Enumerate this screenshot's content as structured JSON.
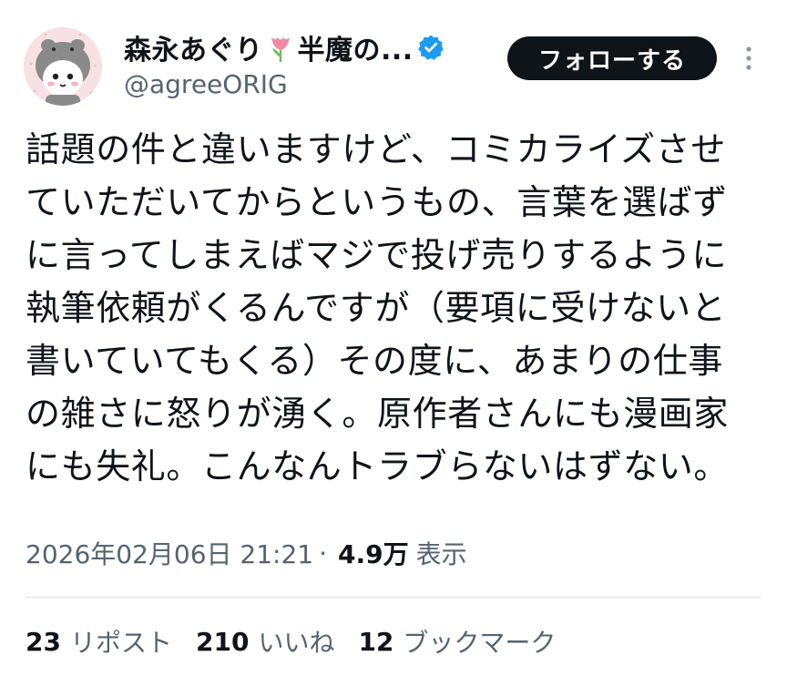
{
  "author": {
    "display_name": "森永あぐり",
    "display_name_suffix": "半魔の...",
    "name_emoji": "tulip-icon",
    "verified_icon": "verified-badge-icon",
    "handle": "@agreeORIG",
    "avatar_colors": {
      "background": "#f6e2e4",
      "hair": "#8a8a8a",
      "face": "#ffffff"
    }
  },
  "follow_button": {
    "label": "フォローする"
  },
  "more_icon": "more-vertical-icon",
  "tweet": {
    "lines": [
      "話題の件と違いますけど、コミカライズさせ",
      "ていただいてからというもの、言葉を選ばず",
      "に言ってしまえばマジで投げ売りするように",
      "執筆依頼がくるんですが（要項に受けないと",
      "書いていてもくる）その度に、あまりの仕事",
      "の雑さに怒りが湧く。原作者さんにも漫画家",
      "にも失礼。こんなんトラブらないはずない。"
    ]
  },
  "meta": {
    "timestamp": "2026年02月06日 21:21",
    "separator": "·",
    "views_count": "4.9万",
    "views_label": "表示"
  },
  "stats": [
    {
      "count": "23",
      "label": "リポスト"
    },
    {
      "count": "210",
      "label": "いいね"
    },
    {
      "count": "12",
      "label": "ブックマーク"
    }
  ],
  "colors": {
    "text_primary": "#0f1419",
    "text_secondary": "#536471",
    "verified_blue": "#1d9bf0",
    "follow_bg": "#0f1419",
    "tulip_pink": "#f28aa5",
    "tulip_green": "#6bbf59"
  }
}
